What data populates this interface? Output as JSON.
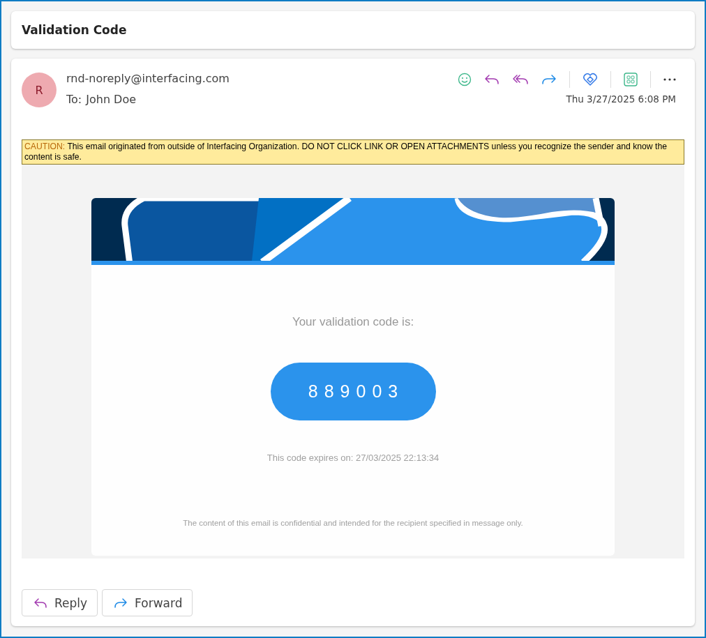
{
  "window": {
    "title": "Validation Code"
  },
  "message": {
    "avatar_initial": "R",
    "sender": "rnd-noreply@interfacing.com",
    "to_label": "To:",
    "to": "John Doe",
    "date": "Thu 3/27/2025 6:08 PM"
  },
  "caution": {
    "label": "CAUTION:",
    "text": "This email originated from outside of Interfacing Organization. DO NOT CLICK LINK OR OPEN ATTACHMENTS unless you recognize the sender and know the content is safe."
  },
  "email_body": {
    "intro": "Your validation code is:",
    "code": "889003",
    "expiry": "This code expires on: 27/03/2025 22:13:34",
    "footer": "The content of this email is confidential and intended for the recipient specified in message only."
  },
  "actions": [
    {
      "kind": "reply",
      "label": "Reply"
    },
    {
      "kind": "forward",
      "label": "Forward"
    }
  ]
}
